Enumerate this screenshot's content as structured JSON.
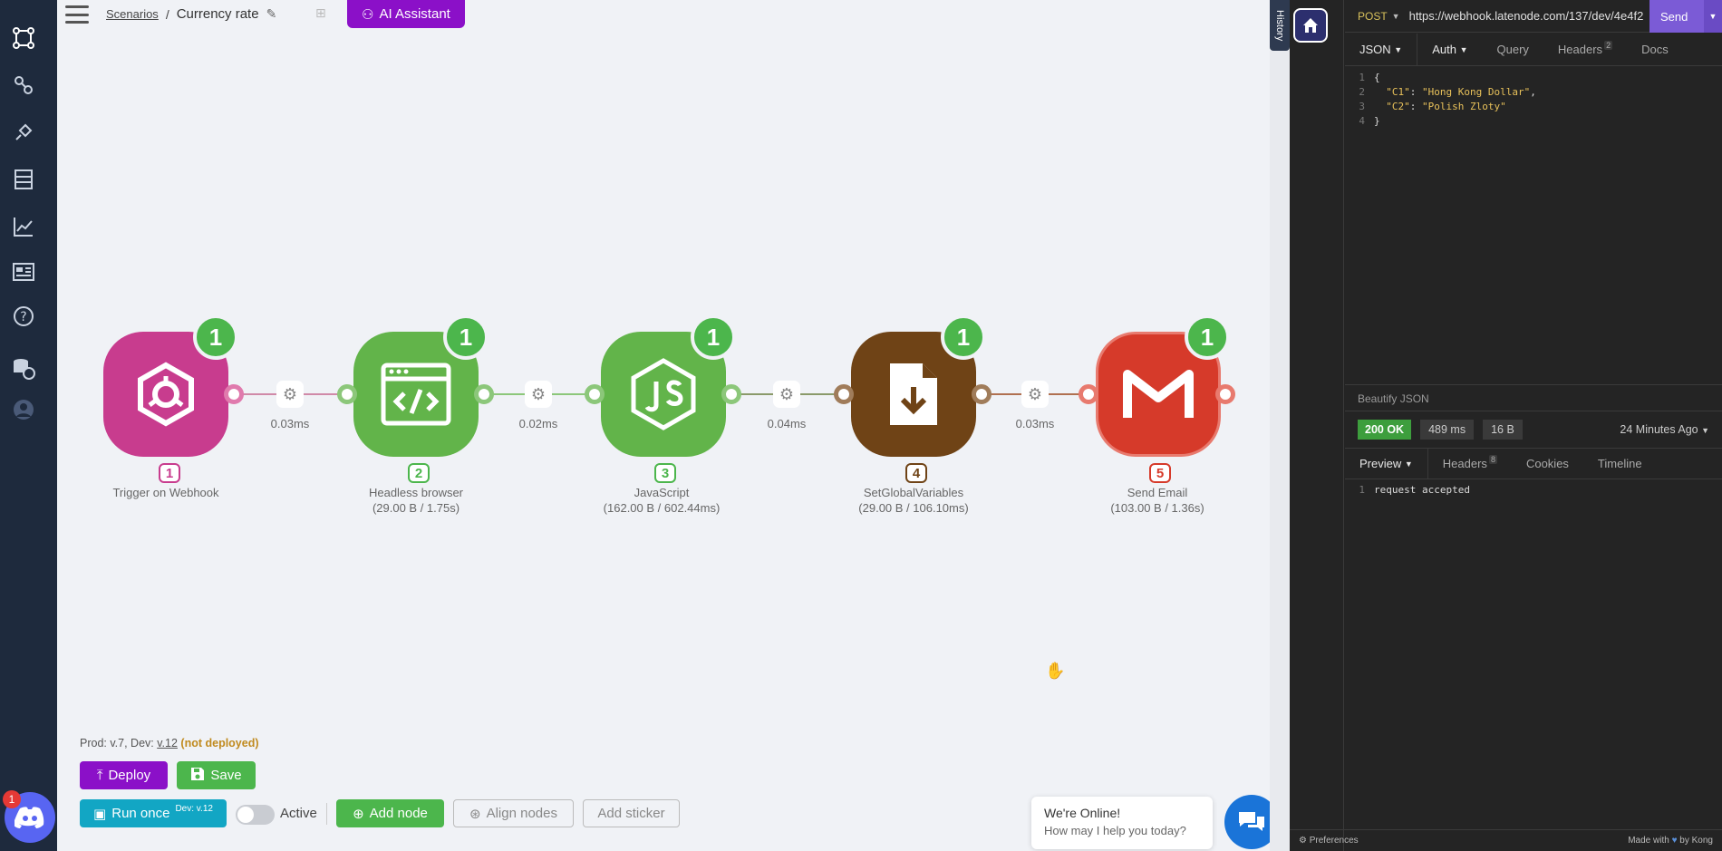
{
  "topbar": {
    "breadcrumb_root": "Scenarios",
    "breadcrumb_sep": "/",
    "scenario_name": "Currency rate",
    "ai_assistant_label": "AI Assistant"
  },
  "nodes": [
    {
      "index": "1",
      "badge": "1",
      "label": "Trigger on Webhook",
      "stats": "",
      "color": "#c83c8e",
      "icon": "webhook-icon"
    },
    {
      "index": "2",
      "badge": "1",
      "label": "Headless browser",
      "stats": "(29.00 B / 1.75s)",
      "color": "#62b44a",
      "icon": "code-browser-icon"
    },
    {
      "index": "3",
      "badge": "1",
      "label": "JavaScript",
      "stats": "(162.00 B / 602.44ms)",
      "color": "#62b44a",
      "icon": "javascript-icon"
    },
    {
      "index": "4",
      "badge": "1",
      "label": "SetGlobalVariables",
      "stats": "(29.00 B / 106.10ms)",
      "color": "#6f4316",
      "icon": "file-download-icon"
    },
    {
      "index": "5",
      "badge": "1",
      "label": "Send Email",
      "stats": "(103.00 B / 1.36s)",
      "color": "#d63a2a",
      "icon": "gmail-icon"
    }
  ],
  "connections": [
    {
      "timing": "0.03ms"
    },
    {
      "timing": "0.02ms"
    },
    {
      "timing": "0.04ms"
    },
    {
      "timing": "0.03ms"
    }
  ],
  "bottom": {
    "version_prefix": "Prod: v.7, Dev: ",
    "version_dev": "v.12",
    "version_status": "(not deployed)",
    "deploy_label": "Deploy",
    "save_label": "Save",
    "run_once_label": "Run once",
    "run_once_sup": "Dev: v.12",
    "active_label": "Active",
    "add_node_label": "Add node",
    "align_nodes_label": "Align nodes",
    "add_sticker_label": "Add sticker"
  },
  "chat": {
    "title": "We're Online!",
    "subtitle": "How may I help you today?",
    "discord_badge": "1"
  },
  "history_tab": "History",
  "client": {
    "method": "POST",
    "url": "https://webhook.latenode.com/137/dev/4e4f2",
    "send_label": "Send",
    "tabs": {
      "json": "JSON",
      "auth": "Auth",
      "query": "Query",
      "headers": "Headers",
      "headers_count": "2",
      "docs": "Docs"
    },
    "body_lines": [
      {
        "n": "1",
        "text": "{"
      },
      {
        "n": "2",
        "key": "\"C1\"",
        "value": "\"Hong Kong Dollar\"",
        "trail": ","
      },
      {
        "n": "3",
        "key": "\"C2\"",
        "value": "\"Polish Zloty\"",
        "trail": ""
      },
      {
        "n": "4",
        "text": "}"
      }
    ],
    "beautify": "Beautify JSON",
    "status": "200 OK",
    "time": "489 ms",
    "size": "16 B",
    "ago": "24 Minutes Ago",
    "resp_tabs": {
      "preview": "Preview",
      "headers": "Headers",
      "headers_count": "8",
      "cookies": "Cookies",
      "timeline": "Timeline"
    },
    "resp_line_no": "1",
    "resp_body": "request accepted",
    "footer_left": "Preferences",
    "footer_right": "Made with",
    "footer_brand": "by Kong"
  },
  "colors": {
    "rail": "#1e2a3d",
    "accent_purple": "#8b10c8",
    "accent_green": "#4cb64c",
    "accent_teal": "#12a6c4",
    "panel": "#242424"
  }
}
